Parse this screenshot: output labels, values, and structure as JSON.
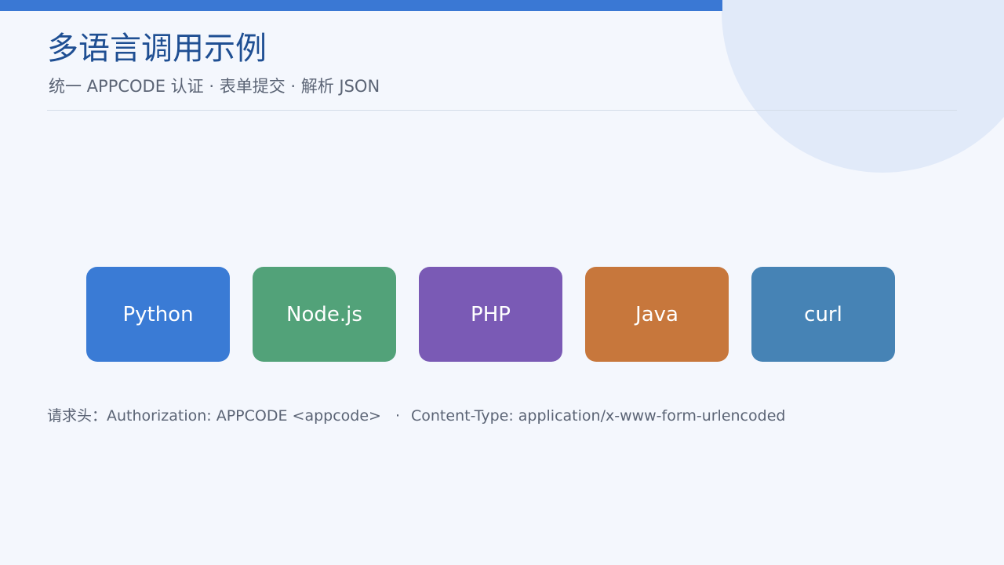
{
  "slide": {
    "title": "多语言调用示例",
    "subtitle": "统一 APPCODE 认证 · 表单提交 · 解析 JSON"
  },
  "languages": [
    {
      "label": "Python",
      "color": "#3a7bd5"
    },
    {
      "label": "Node.js",
      "color": "#52a279"
    },
    {
      "label": "PHP",
      "color": "#7a5ab5"
    },
    {
      "label": "Java",
      "color": "#c7773c"
    },
    {
      "label": "curl",
      "color": "#4683b5"
    }
  ],
  "headers": {
    "prefix": "请求头：",
    "authorization": "Authorization: APPCODE <appcode>",
    "separator": "·",
    "content_type": "Content-Type: application/x-www-form-urlencoded"
  },
  "colors": {
    "accent": "#3a78d4",
    "title": "#1f4f93",
    "background": "#f4f7fd",
    "decoration": "#e1eaf9"
  }
}
